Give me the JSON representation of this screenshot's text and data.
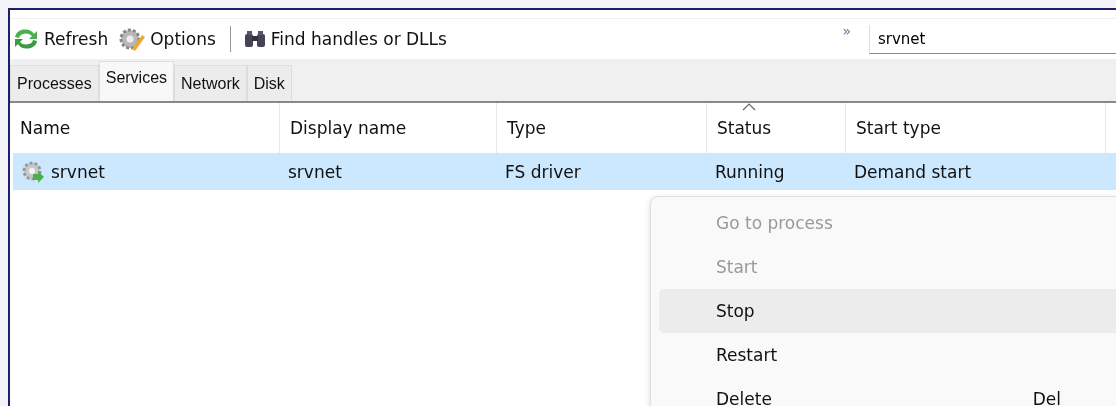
{
  "toolbar": {
    "buttons": [
      {
        "label": "Refresh",
        "kind": "refresh"
      },
      {
        "label": "Options",
        "kind": "options"
      },
      {
        "label": "Find handles or DLLs",
        "kind": "find"
      }
    ],
    "chevron": "»",
    "search": {
      "value": "srvnet"
    }
  },
  "tabs": [
    {
      "label": "Processes",
      "selected": false
    },
    {
      "label": "Services",
      "selected": true
    },
    {
      "label": "Network",
      "selected": false
    },
    {
      "label": "Disk",
      "selected": false
    }
  ],
  "table": {
    "columns": [
      {
        "label": "Name",
        "sorted": false
      },
      {
        "label": "Display name",
        "sorted": false
      },
      {
        "label": "Type",
        "sorted": false
      },
      {
        "label": "Status",
        "sorted": true
      },
      {
        "label": "Start type",
        "sorted": false
      }
    ],
    "rows": [
      {
        "cells": [
          "srvnet",
          "srvnet",
          "FS driver",
          "Running",
          "Demand start"
        ],
        "selected": true
      }
    ]
  },
  "context_menu": {
    "items": [
      {
        "label": "Go to process",
        "disabled": true,
        "selected": false
      },
      {
        "label": "Start",
        "disabled": true,
        "selected": false
      },
      {
        "label": "Stop",
        "disabled": false,
        "selected": true
      },
      {
        "label": "Restart",
        "disabled": false,
        "selected": false
      },
      {
        "label": "Delete",
        "disabled": false,
        "selected": false,
        "shortcut": "Del"
      }
    ]
  }
}
